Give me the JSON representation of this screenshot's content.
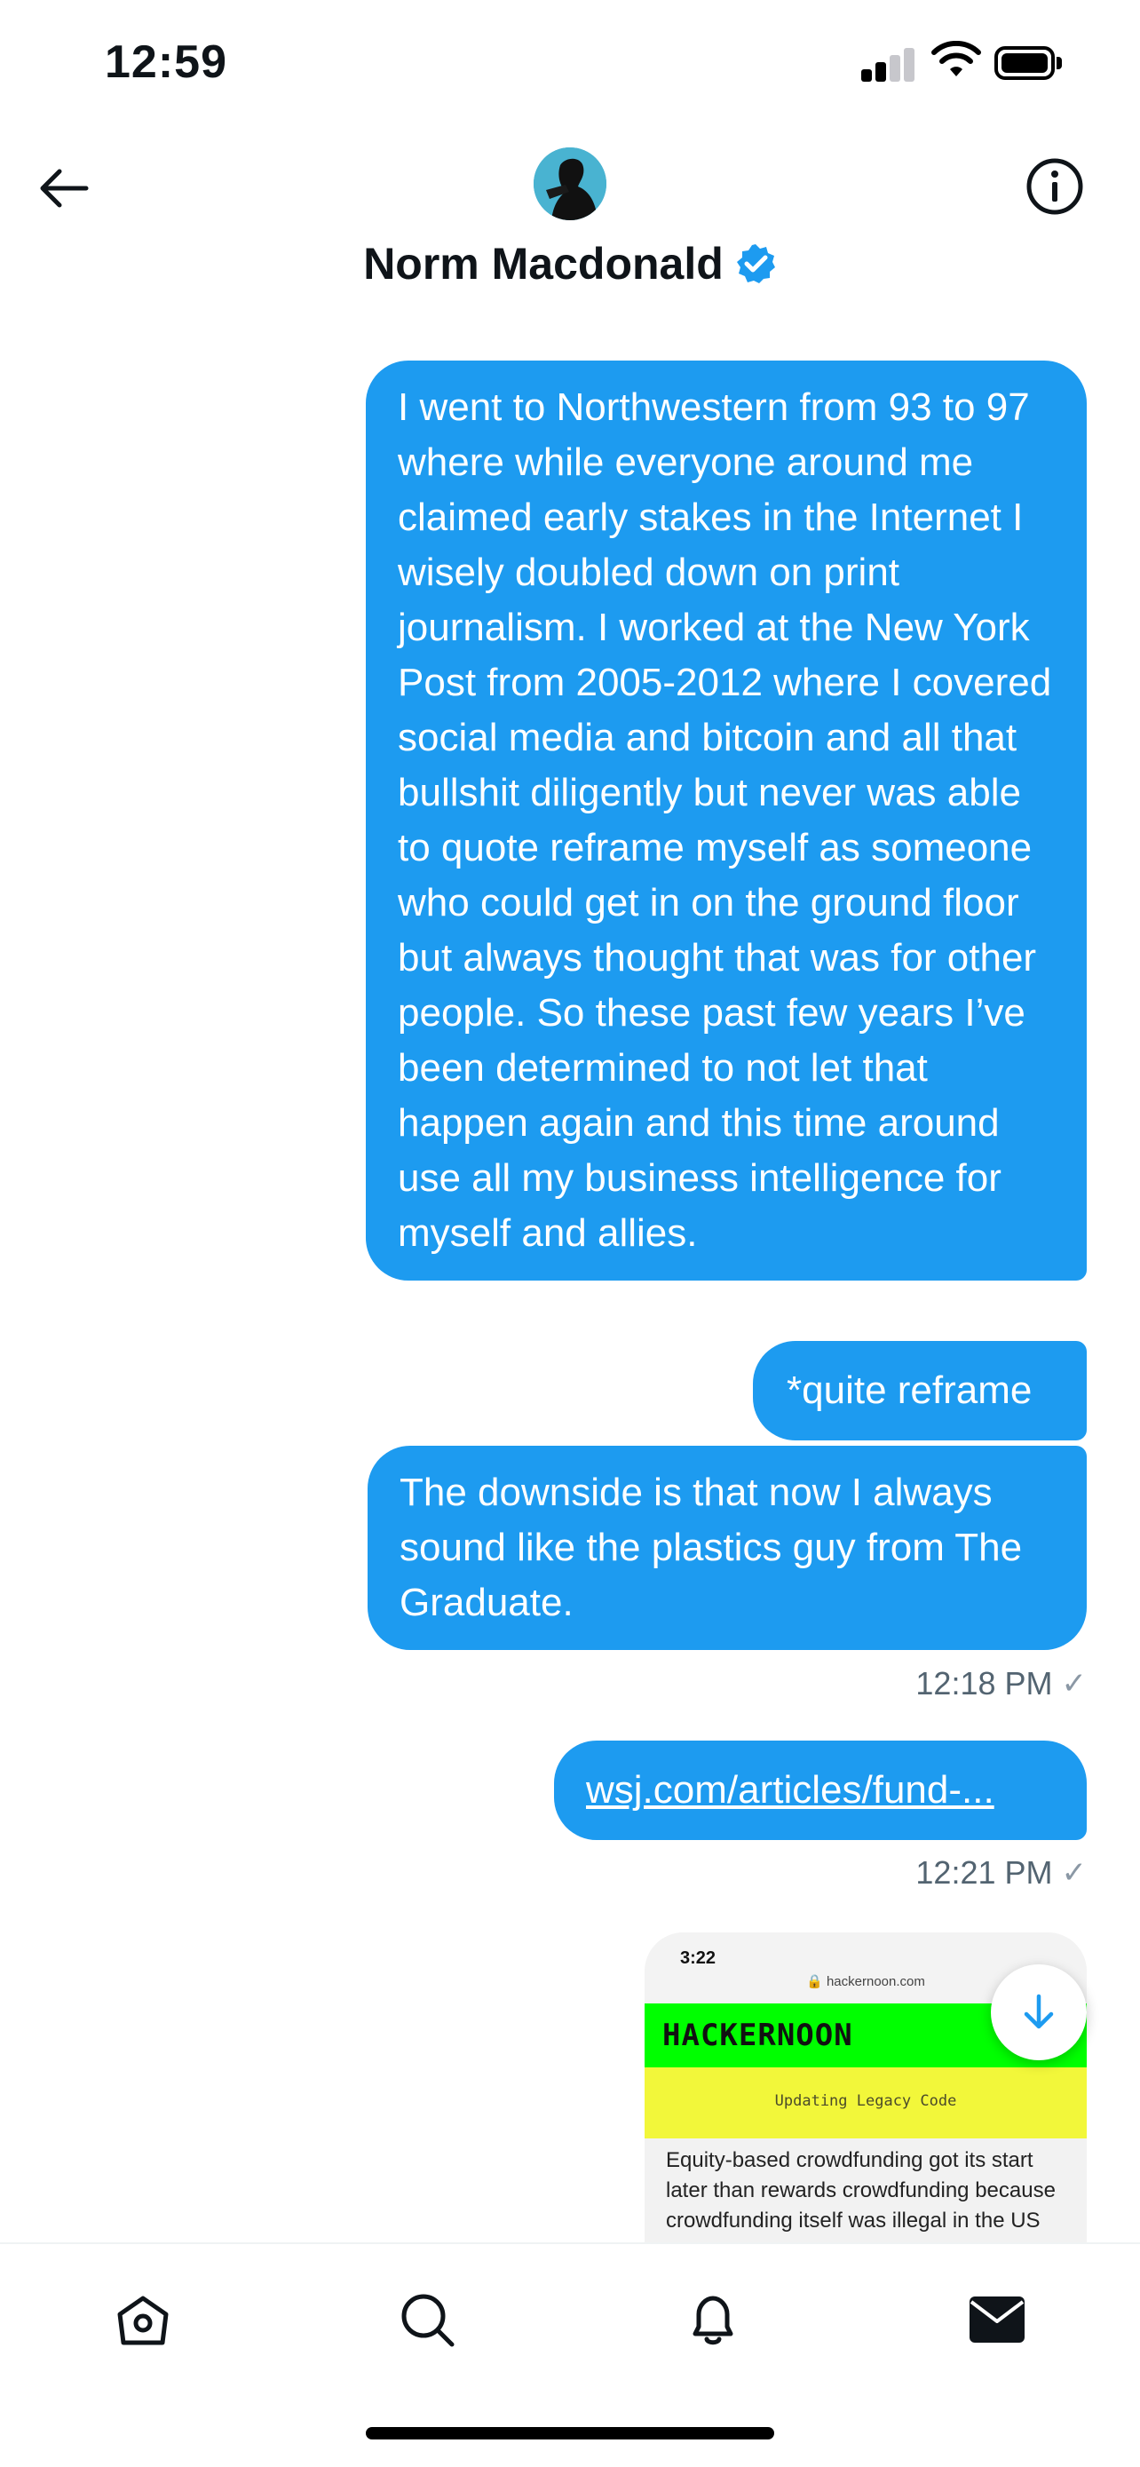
{
  "status_bar": {
    "time": "12:59",
    "icons": [
      "cellular-signal-icon",
      "wifi-icon",
      "battery-icon"
    ]
  },
  "header": {
    "contact_name": "Norm Macdonald",
    "verified": true,
    "icons": [
      "back-arrow-icon",
      "avatar",
      "verified-badge-icon",
      "info-icon"
    ]
  },
  "conversation": {
    "messages": [
      {
        "text": "I went to Northwestern from 93 to 97 where while everyone around me claimed early stakes in the Internet I wisely doubled down on print journalism. I worked at the New York Post from 2005-2012 where I covered social media and bitcoin and all that bullshit diligently but never was able to quote reframe myself as someone who could get in on the ground floor but always thought that was for other people. So these past few years I’ve been determined to not let that happen again and this time around use all my business intelligence for myself and allies."
      },
      {
        "text": "*quite reframe"
      },
      {
        "text": "The downside is that now I always sound like the plastics guy from The Graduate."
      },
      {
        "text": "wsj.com/articles/fund-..."
      }
    ],
    "timestamps": [
      "12:18 PM",
      "12:21 PM"
    ],
    "read_check": "✓",
    "link_card": {
      "preview_time": "3:22",
      "preview_url": "🔒 hackernoon.com",
      "site_logo": "HACKERNOON",
      "tag": "Updating Legacy Code",
      "snippet": "Equity-based crowdfunding got its start later than rewards crowdfunding because crowdfunding itself was illegal in the US"
    }
  },
  "tab_bar": {
    "tabs": [
      "home-icon",
      "search-icon",
      "notifications-bell-icon",
      "messages-envelope-icon"
    ]
  },
  "colors": {
    "bubble": "#1d9bf0",
    "verified": "#1d9bf0",
    "timestamp": "#536471"
  }
}
